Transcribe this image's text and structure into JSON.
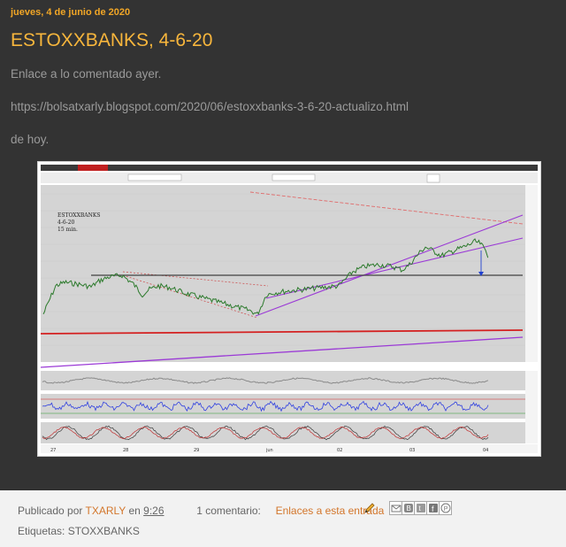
{
  "post": {
    "date": "jueves, 4 de junio de 2020",
    "title": "ESTOXXBANKS, 4-6-20",
    "lines": [
      "Enlace a lo comentado ayer.",
      "https://bolsatxarly.blogspot.com/2020/06/estoxxbanks-3-6-20-actualizo.html",
      "de hoy."
    ]
  },
  "chart_image": {
    "annotation": [
      "ESTOXXBANKS",
      "4-6-20",
      "15 min."
    ],
    "x_labels": [
      "27",
      "28",
      "29",
      "jun",
      "02",
      "03",
      "04"
    ],
    "colors": {
      "price_bg": "#d4d4d4",
      "channel": "#9b3ad6",
      "red_line": "#d42020",
      "support": "#404040",
      "candles": "#2c7a2c",
      "blue_osc": "#3040e0"
    }
  },
  "footer": {
    "published_by": "Publicado por",
    "author": "TXARLY",
    "at": "en",
    "time": "9:26",
    "comments": "1 comentario:",
    "links_to_post": "Enlaces a esta entrada",
    "labels_prefix": "Etiquetas:",
    "label": "STOXXBANKS",
    "share_icons": [
      "email-icon",
      "blog-icon",
      "twitter-icon",
      "facebook-icon",
      "pinterest-icon"
    ]
  }
}
